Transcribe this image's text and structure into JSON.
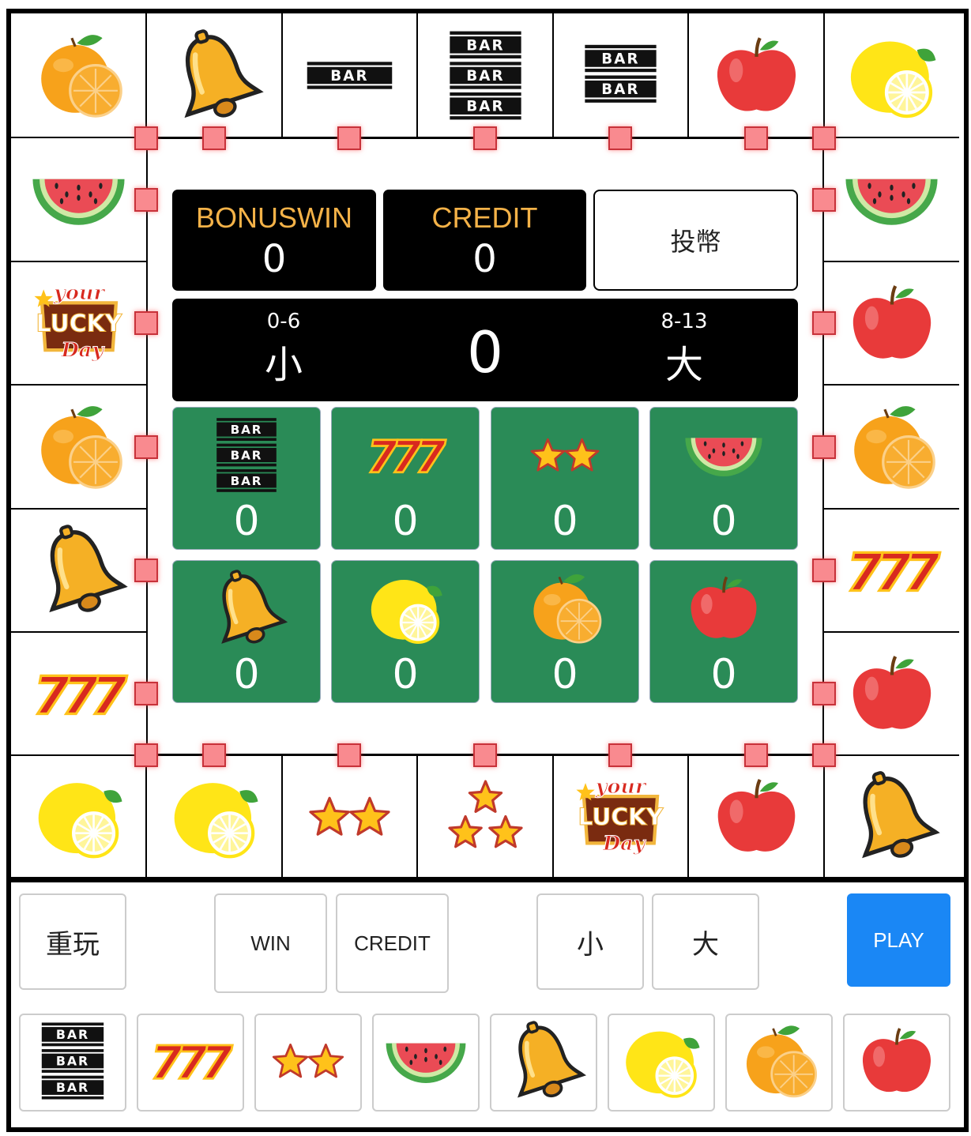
{
  "symbols": {
    "orange": "orange-icon",
    "bell": "bell-icon",
    "bar1": "single-bar-icon",
    "bar2": "double-bar-icon",
    "bar3": "triple-bar-icon",
    "apple": "apple-icon",
    "lemon": "lemon-icon",
    "watermelon": "watermelon-icon",
    "seven": "triple-seven-icon",
    "star2": "two-stars-icon",
    "star3": "three-stars-icon",
    "lucky": "lucky-day-logo"
  },
  "bar_text": "BAR",
  "lucky_text": {
    "line1": "your",
    "line2": "LUCKY",
    "line3": "Day"
  },
  "board": {
    "top_row": [
      "orange",
      "bell",
      "bar1",
      "bar3",
      "bar2",
      "apple",
      "lemon"
    ],
    "left_col": [
      "watermelon",
      "lucky",
      "orange",
      "bell",
      "seven"
    ],
    "right_col": [
      "watermelon",
      "apple",
      "orange",
      "seven",
      "apple"
    ],
    "bottom_row": [
      "lemon",
      "lemon",
      "star2",
      "star3",
      "lucky",
      "apple",
      "bell"
    ]
  },
  "display": {
    "bonuswin": {
      "label": "BONUSWIN",
      "value": "0"
    },
    "credit": {
      "label": "CREDIT",
      "value": "0"
    },
    "insert_coin": "投幣",
    "small": {
      "range": "0-6",
      "label": "小"
    },
    "big": {
      "range": "8-13",
      "label": "大"
    },
    "result": "0"
  },
  "bets": [
    {
      "symbol": "bar3",
      "value": "0"
    },
    {
      "symbol": "seven",
      "value": "0"
    },
    {
      "symbol": "star2",
      "value": "0"
    },
    {
      "symbol": "watermelon",
      "value": "0"
    },
    {
      "symbol": "bell",
      "value": "0"
    },
    {
      "symbol": "lemon",
      "value": "0"
    },
    {
      "symbol": "orange",
      "value": "0"
    },
    {
      "symbol": "apple",
      "value": "0"
    }
  ],
  "controls": {
    "replay": "重玩",
    "win": "WIN",
    "credit": "CREDIT",
    "small": "小",
    "big": "大",
    "play": "PLAY"
  },
  "symbol_buttons": [
    "bar3",
    "seven",
    "star2",
    "watermelon",
    "bell",
    "lemon",
    "orange",
    "apple"
  ],
  "colors": {
    "bet_panel": "#2a8b57",
    "label_gold": "#f4b248",
    "play_blue": "#1a87f5",
    "light_marker": "#f98a8f"
  }
}
